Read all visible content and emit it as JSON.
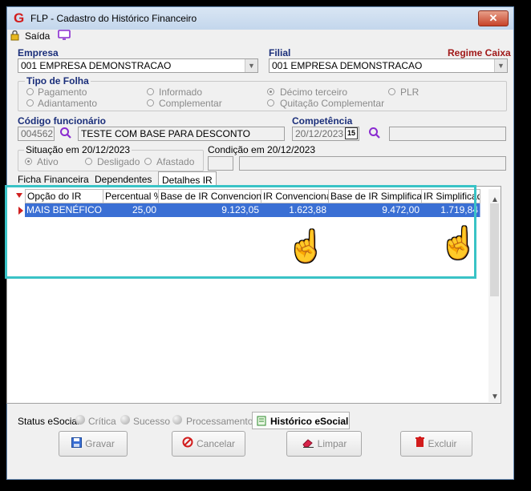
{
  "window": {
    "title": "FLP - Cadastro do Histórico Financeiro",
    "close": "✕"
  },
  "toolbar": {
    "exit_label": "Saída"
  },
  "empresa": {
    "label": "Empresa",
    "value": "001 EMPRESA DEMONSTRACAO"
  },
  "filial": {
    "label": "Filial",
    "value": "001 EMPRESA DEMONSTRACAO"
  },
  "regime": {
    "label": "Regime Caixa"
  },
  "tipo_folha": {
    "label": "Tipo de Folha",
    "options": [
      "Pagamento",
      "Informado",
      "Décimo terceiro",
      "PLR",
      "Adiantamento",
      "Complementar",
      "Quitação Complementar"
    ],
    "selected": "Décimo terceiro"
  },
  "funcionario": {
    "label": "Código funcionário",
    "code": "004562",
    "name": "TESTE COM BASE PARA DESCONTO"
  },
  "competencia": {
    "label": "Competência",
    "value": "20/12/2023",
    "cal": "15"
  },
  "situacao": {
    "label": "Situação em  20/12/2023",
    "options": [
      "Ativo",
      "Desligado",
      "Afastado"
    ],
    "selected": "Ativo"
  },
  "condicao": {
    "label": "Condição em 20/12/2023"
  },
  "tabs": [
    "Ficha Financeira",
    "Dependentes",
    "Detalhes IR"
  ],
  "grid": {
    "columns": [
      "Opção do IR",
      "Percentual %",
      "Base de IR Convencional",
      "IR Convencional",
      "Base de IR Simplificado",
      "IR Simplificado"
    ],
    "rows": [
      [
        "MAIS BENÉFICO",
        "25,00",
        "9.123,05",
        "1.623,88",
        "9.472,00",
        "1.719,84"
      ]
    ]
  },
  "status": {
    "label": "Status eSocial:",
    "items": [
      "Crítica",
      "Sucesso",
      "Processamento"
    ],
    "history_label": "Histórico eSocial"
  },
  "buttons": {
    "save": "Gravar",
    "cancel": "Cancelar",
    "clear": "Limpar",
    "delete": "Excluir"
  },
  "colors": {
    "accent": "#39c3c6",
    "selection": "#3a6fd4",
    "label_blue": "#1a2e7a",
    "regime_red": "#a01818"
  }
}
